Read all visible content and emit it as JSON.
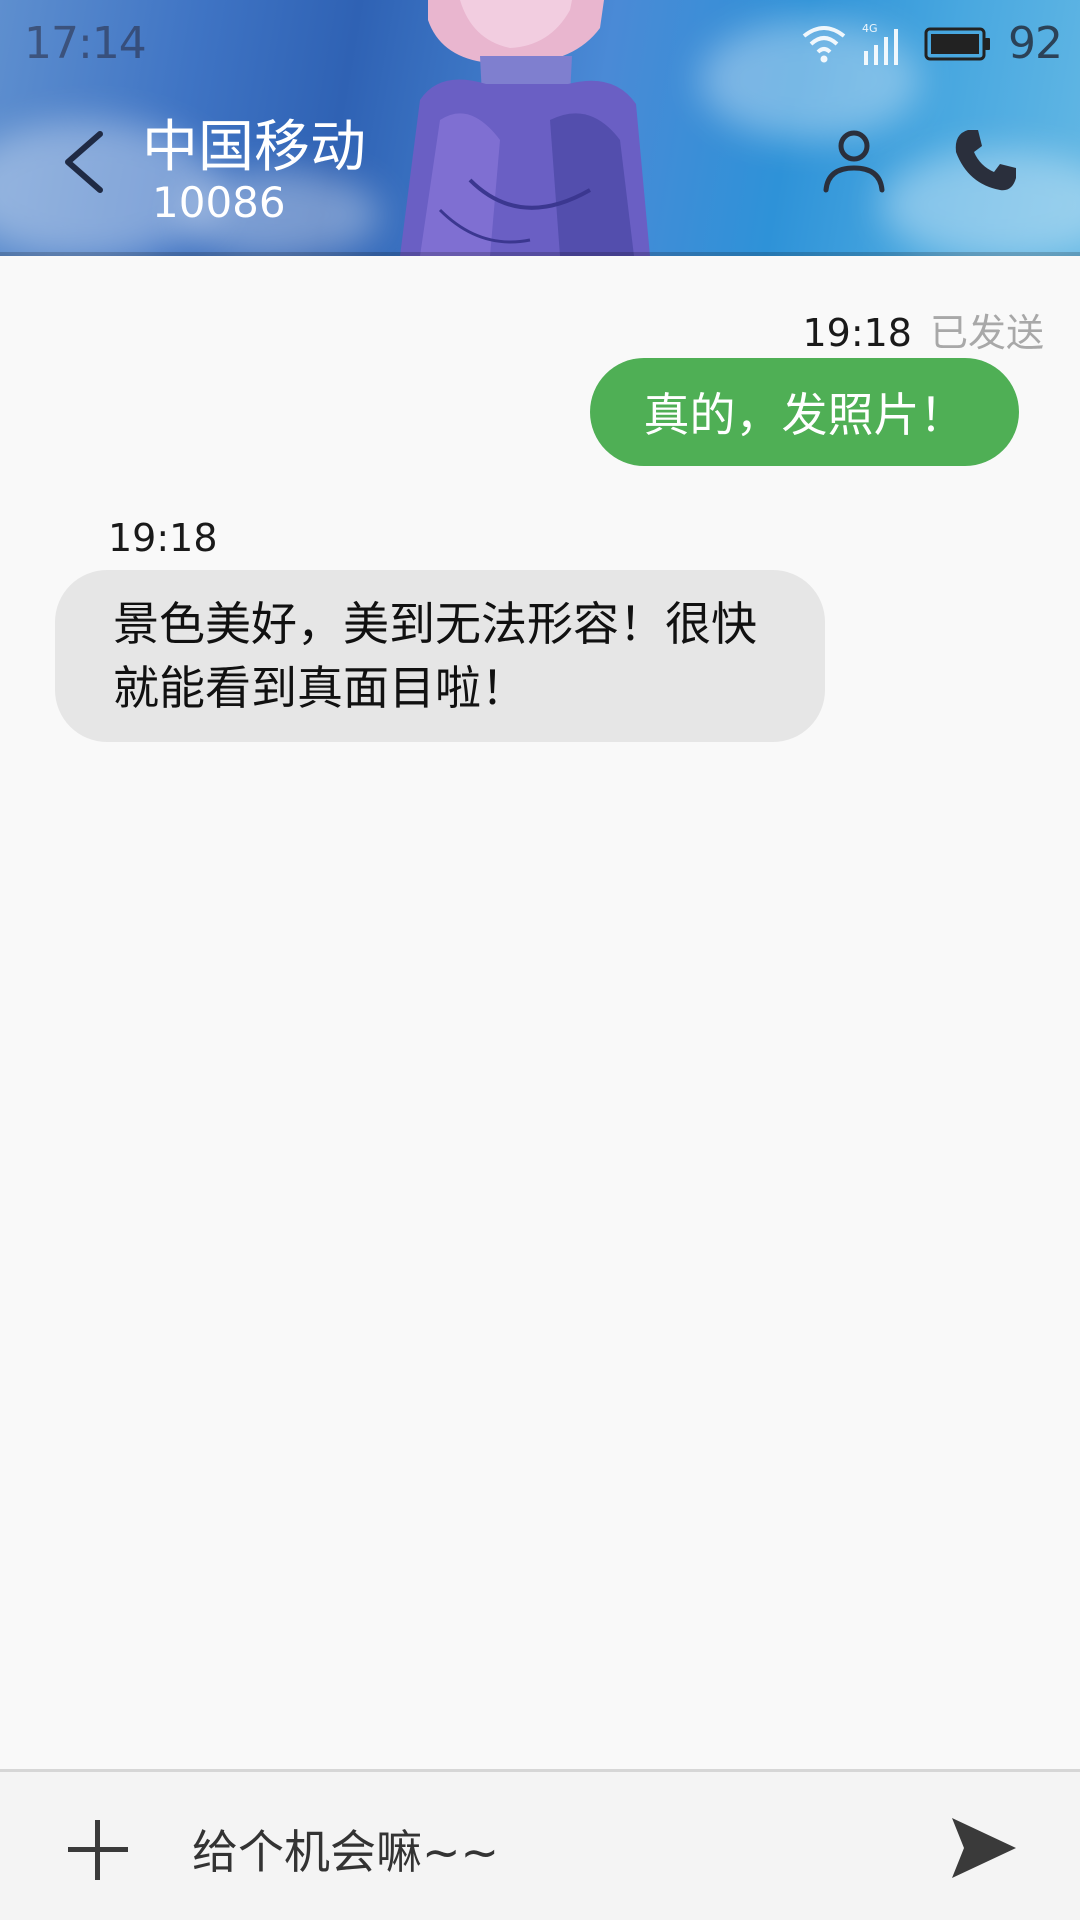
{
  "status_bar": {
    "time": "17:14",
    "network": "4G",
    "battery": "92"
  },
  "header": {
    "contact_name": "中国移动",
    "contact_number": "10086"
  },
  "messages": {
    "sent": {
      "time": "19:18",
      "status": "已发送",
      "text": "真的，发照片！"
    },
    "received": {
      "time": "19:18",
      "text": "景色美好，美到无法形容！很快就能看到真面目啦！"
    }
  },
  "composer": {
    "value": "给个机会嘛~~"
  },
  "colors": {
    "sent_bubble": "#4faf55",
    "received_bubble": "#e6e6e6",
    "background": "#f9f9f9"
  }
}
